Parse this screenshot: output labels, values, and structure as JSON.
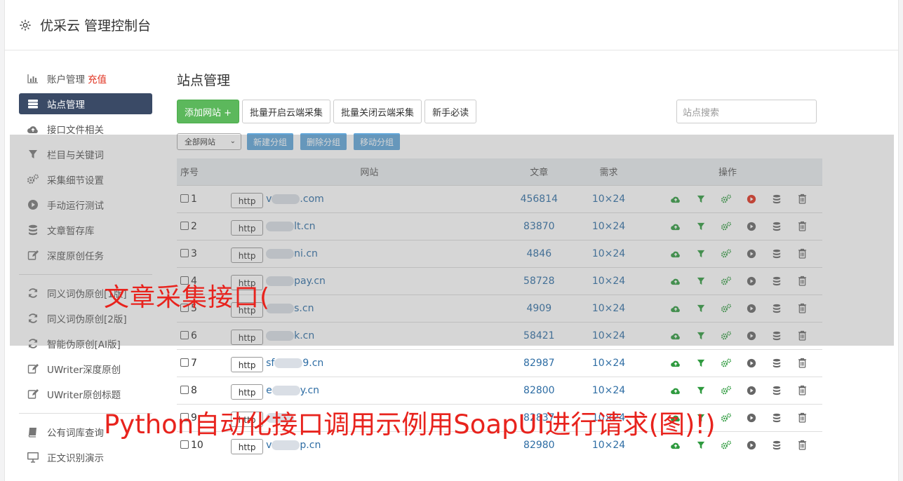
{
  "header": {
    "title": "优采云 管理控制台"
  },
  "sidebar": {
    "items": [
      {
        "label": "账户管理",
        "extra": "充值",
        "icon": "bar-chart-icon"
      },
      {
        "label": "站点管理",
        "icon": "server-icon",
        "active": true
      },
      {
        "label": "接口文件相关",
        "icon": "cloud-upload-icon"
      },
      {
        "label": "栏目与关键词",
        "icon": "filter-icon"
      },
      {
        "label": "采集细节设置",
        "icon": "cogs-icon"
      },
      {
        "label": "手动运行测试",
        "icon": "play-circle-icon"
      },
      {
        "label": "文章暂存库",
        "icon": "database-icon"
      },
      {
        "label": "深度原创任务",
        "icon": "edit-icon"
      }
    ],
    "group2": [
      {
        "label": "同义词伪原创[1版]",
        "icon": "refresh-icon"
      },
      {
        "label": "同义词伪原创[2版]",
        "icon": "refresh-icon"
      },
      {
        "label": "智能伪原创[AI版]",
        "icon": "refresh-icon"
      },
      {
        "label": "UWriter深度原创",
        "icon": "edit-icon"
      },
      {
        "label": "UWriter原创标题",
        "icon": "edit-icon"
      }
    ],
    "group3": [
      {
        "label": "公有词库查询",
        "icon": "book-icon"
      },
      {
        "label": "正文识别演示",
        "icon": "monitor-icon"
      }
    ]
  },
  "main": {
    "title": "站点管理",
    "toolbar": {
      "add": "添加网站 +",
      "batch_open": "批量开启云端采集",
      "batch_close": "批量关闭云端采集",
      "guide": "新手必读",
      "search_placeholder": "站点搜索"
    },
    "group": {
      "select": "全部网站",
      "new": "新建分组",
      "delete": "删除分组",
      "move": "移动分组"
    },
    "table": {
      "headers": [
        "序号",
        "网站",
        "文章",
        "需求",
        "操作"
      ],
      "rows": [
        {
          "idx": "1",
          "proto": "http",
          "site": ".com",
          "prefix": "v",
          "articles": "456814",
          "req": "10×24",
          "run": "active"
        },
        {
          "idx": "2",
          "proto": "http",
          "site": "lt.cn",
          "prefix": "",
          "articles": "83870",
          "req": "10×24",
          "run": "idle"
        },
        {
          "idx": "3",
          "proto": "http",
          "site": "ni.cn",
          "prefix": "",
          "articles": "4846",
          "req": "10×24",
          "run": "idle"
        },
        {
          "idx": "4",
          "proto": "http",
          "site": "pay.cn",
          "prefix": "",
          "articles": "58728",
          "req": "10×24",
          "run": "idle"
        },
        {
          "idx": "5",
          "proto": "http",
          "site": "s.cn",
          "prefix": "",
          "articles": "4909",
          "req": "10×24",
          "run": "idle"
        },
        {
          "idx": "6",
          "proto": "http",
          "site": "k.cn",
          "prefix": "",
          "articles": "58421",
          "req": "10×24",
          "run": "idle"
        },
        {
          "idx": "7",
          "proto": "http",
          "site": "9.cn",
          "prefix": "sf",
          "articles": "82987",
          "req": "10×24",
          "run": "idle"
        },
        {
          "idx": "8",
          "proto": "http",
          "site": "y.cn",
          "prefix": "e",
          "articles": "82800",
          "req": "10×24",
          "run": "idle"
        },
        {
          "idx": "9",
          "proto": "http",
          "site": "",
          "prefix": "",
          "articles": "82837",
          "req": "10×24",
          "run": "idle"
        },
        {
          "idx": "10",
          "proto": "http",
          "site": "p.cn",
          "prefix": "v",
          "articles": "82980",
          "req": "10×24",
          "run": "idle"
        }
      ]
    }
  },
  "watermark": {
    "line1": "文章采集接口(",
    "line2": "Python自动化接口调用示例用SoapUI进行请求(图)!)"
  },
  "colors": {
    "green": "#2e9a3e",
    "red": "#e0301e",
    "blue": "#2e6da4",
    "sidebar_active": "#3a4a66"
  }
}
